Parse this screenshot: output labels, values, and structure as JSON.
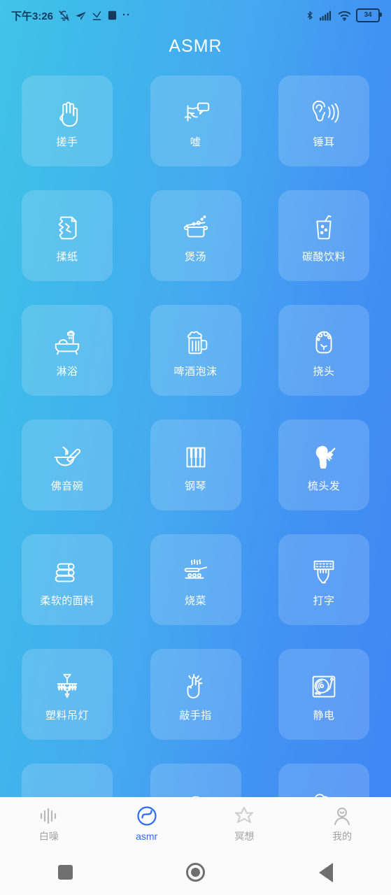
{
  "status_bar": {
    "time": "下午3:26",
    "left_icons": [
      "mute-bell-icon",
      "send-arrow-icon",
      "download-check-icon",
      "square-app-icon",
      "more-dots-icon"
    ],
    "more_dots": "··",
    "right_icons": [
      "bluetooth-icon",
      "cellular-signal-icon",
      "wifi-icon"
    ],
    "battery_level": "34"
  },
  "header": {
    "title": "ASMR"
  },
  "grid": {
    "cards": [
      {
        "label": "搓手",
        "icon": "hand-rub-icon"
      },
      {
        "label": "嘘",
        "icon": "shush-speech-icon"
      },
      {
        "label": "锤耳",
        "icon": "ear-sound-icon"
      },
      {
        "label": "揉纸",
        "icon": "crumpled-paper-icon"
      },
      {
        "label": "煲汤",
        "icon": "soup-pot-icon"
      },
      {
        "label": "碳酸饮料",
        "icon": "soda-glass-icon"
      },
      {
        "label": "淋浴",
        "icon": "bathtub-shower-icon"
      },
      {
        "label": "啤酒泡沫",
        "icon": "beer-mug-icon"
      },
      {
        "label": "挠头",
        "icon": "head-scratch-icon"
      },
      {
        "label": "佛音碗",
        "icon": "singing-bowl-icon"
      },
      {
        "label": "钢琴",
        "icon": "piano-keys-icon"
      },
      {
        "label": "梳头发",
        "icon": "hair-brush-icon"
      },
      {
        "label": "柔软的面料",
        "icon": "folded-towels-icon"
      },
      {
        "label": "烧菜",
        "icon": "frying-pan-stove-icon"
      },
      {
        "label": "打字",
        "icon": "typing-keyboard-icon"
      },
      {
        "label": "塑料吊灯",
        "icon": "chandelier-icon"
      },
      {
        "label": "敲手指",
        "icon": "tapping-finger-icon"
      },
      {
        "label": "静电",
        "icon": "turntable-icon"
      },
      {
        "label": "",
        "icon": "water-glass-icon"
      },
      {
        "label": "",
        "icon": "face-head-icon"
      },
      {
        "label": "",
        "icon": "clouds-icon"
      }
    ]
  },
  "tab_bar": {
    "active_color": "#2b6cf0",
    "inactive_color": "#a2a2a2",
    "tabs": [
      {
        "label": "白噪",
        "icon": "waveform-icon",
        "active": false
      },
      {
        "label": "asmr",
        "icon": "asmr-wave-icon",
        "active": true
      },
      {
        "label": "冥想",
        "icon": "meditation-star-icon",
        "active": false
      },
      {
        "label": "我的",
        "icon": "user-profile-icon",
        "active": false
      }
    ]
  },
  "nav_bar": {
    "buttons": [
      {
        "name": "recents-button",
        "icon": "square-icon"
      },
      {
        "name": "home-button",
        "icon": "circle-icon"
      },
      {
        "name": "back-button",
        "icon": "triangle-icon"
      }
    ]
  }
}
